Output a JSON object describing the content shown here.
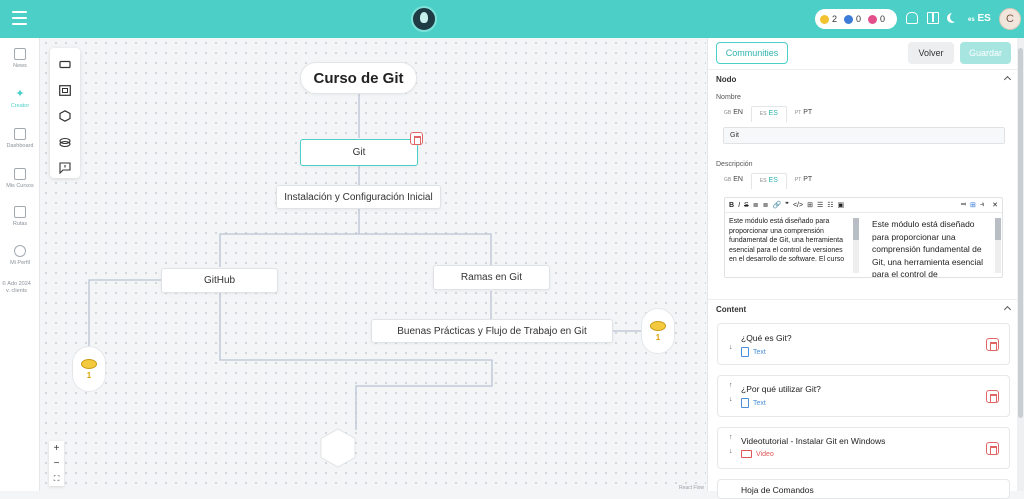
{
  "topbar": {
    "stats": {
      "stars": "2",
      "gems": "0",
      "energy": "0"
    },
    "lang": "ES",
    "lang_flag": "es",
    "avatar_initial": "C"
  },
  "sidebar": {
    "items": [
      {
        "label": "News"
      },
      {
        "label": "Creator"
      },
      {
        "label": "Dashboard"
      },
      {
        "label": "Mis Cursos"
      },
      {
        "label": "Rutas"
      },
      {
        "label": "Mi Perfil"
      }
    ],
    "footer_line1": "© Ado 2024",
    "footer_line2": "v. clients"
  },
  "canvas": {
    "nodes": {
      "title": "Curso de Git",
      "git": "Git",
      "install": "Instalación y Configuración Inicial",
      "github": "GitHub",
      "ramas": "Ramas en Git",
      "buenas": "Buenas Prácticas y Flujo de Trabajo en Git",
      "coin_left": "1",
      "coin_right": "1"
    },
    "zoom": {
      "in": "+",
      "out": "−",
      "fit": "⛶"
    },
    "attribution": "React Flow"
  },
  "panel": {
    "communities_label": "Communities",
    "volver_label": "Volver",
    "guardar_label": "Guardar",
    "nodo_header": "Nodo",
    "nombre_label": "Nombre",
    "descripcion_label": "Descripción",
    "lang_tabs": [
      {
        "flag": "GB",
        "code": "EN"
      },
      {
        "flag": "ES",
        "code": "ES"
      },
      {
        "flag": "PT",
        "code": "PT"
      }
    ],
    "nombre_value": "Git",
    "toolbar": [
      "B",
      "I",
      "S",
      "≣",
      "≣",
      "🔗",
      "❞",
      "</>",
      "⊞",
      "☰",
      "☷",
      "▣"
    ],
    "description_source": "Este módulo está diseñado para proporcionar una comprensión fundamental de Git, una herramienta esencial para el control de versiones en el desarrollo de software. El curso",
    "description_preview": "Este módulo está diseñado para proporcionar una comprensión fundamental de Git, una herramienta esencial para el control de",
    "content_header": "Content",
    "content_items": [
      {
        "title": "¿Qué es Git?",
        "type": "Text"
      },
      {
        "title": "¿Por qué utilizar Git?",
        "type": "Text"
      },
      {
        "title": "Videotutorial - Instalar Git en Windows",
        "type": "Video"
      },
      {
        "title": "Hoja de Comandos",
        "type": ""
      }
    ]
  }
}
